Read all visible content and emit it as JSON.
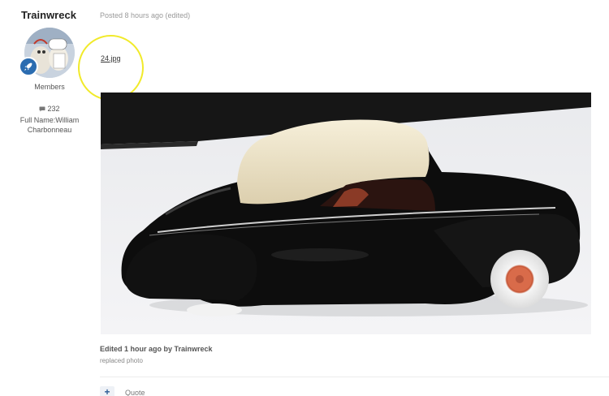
{
  "author": {
    "name": "Trainwreck",
    "group": "Members",
    "post_count": "232",
    "full_name_label": "Full Name:William",
    "full_name_rest": "Charbonneau"
  },
  "post": {
    "meta": "Posted 8 hours ago (edited)",
    "attachment_link": "24.jpg",
    "edited_by": "Edited 1 hour ago by Trainwreck",
    "edit_reason": "replaced photo"
  },
  "actions": {
    "add_label": "+",
    "quote_label": "Quote"
  },
  "colors": {
    "accent": "#2b6cb0",
    "highlight": "#f1ea2a",
    "car_body": "#0d0d0d",
    "car_roof": "#ede2c4",
    "wheel": "#d96b4a"
  }
}
